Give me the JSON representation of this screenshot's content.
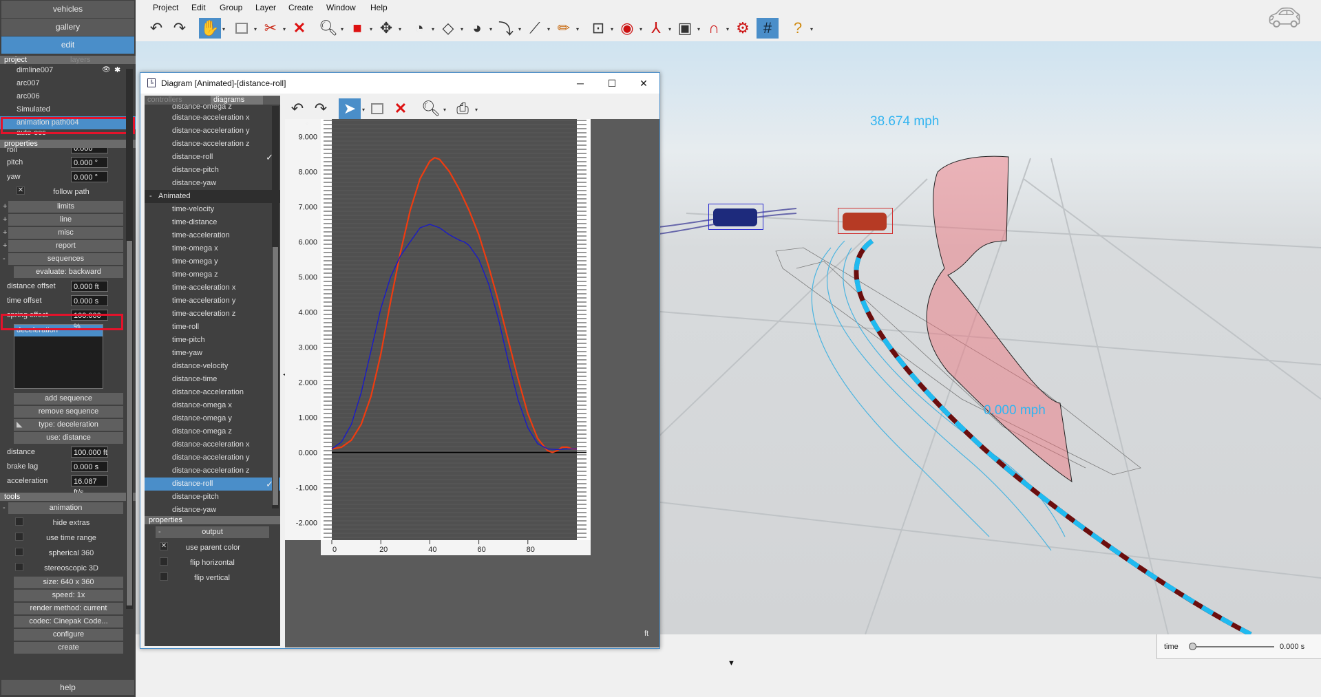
{
  "left_panel": {
    "top_buttons": [
      "vehicles",
      "gallery",
      "edit"
    ],
    "project_tab": "project",
    "layers_tab": "layers",
    "project_items": [
      "dimline007",
      "arc007",
      "arc006",
      "Simulated",
      "animation path004",
      "auto-ees"
    ],
    "properties_label": "properties",
    "props_top": [
      {
        "label": "roll",
        "value": "0.000"
      },
      {
        "label": "pitch",
        "value": "0.000 °"
      },
      {
        "label": "yaw",
        "value": "0.000 °"
      }
    ],
    "follow_path": "follow path",
    "groups": [
      "limits",
      "line",
      "misc",
      "report",
      "sequences"
    ],
    "evaluate": "evaluate: backward",
    "props_seq": [
      {
        "label": "distance offset",
        "value": "0.000 ft"
      },
      {
        "label": "time offset",
        "value": "0.000 s"
      },
      {
        "label": "spring effect",
        "value": "100.000 %"
      }
    ],
    "sequence_list": [
      "deceleration"
    ],
    "add_sequence": "add sequence",
    "remove_sequence": "remove sequence",
    "type": "type: deceleration",
    "use": "use: distance",
    "props_decel": [
      {
        "label": "distance",
        "value": "100.000 ft"
      },
      {
        "label": "brake lag",
        "value": "0.000 s"
      },
      {
        "label": "acceleration",
        "value": "16.087 ft/s"
      }
    ],
    "tools_label": "tools",
    "animation_label": "animation",
    "animation_checks": [
      "hide extras",
      "use time range",
      "spherical 360",
      "stereoscopic 3D"
    ],
    "animation_buttons": [
      "size: 640 x 360",
      "speed: 1x",
      "render method: current",
      "codec: Cinepak Code...",
      "configure",
      "create"
    ],
    "help": "help"
  },
  "menu": [
    "Project",
    "Edit",
    "Group",
    "Layer",
    "Create",
    "Window",
    "Help"
  ],
  "toolbar_icons": [
    "undo-icon",
    "redo-icon",
    "hand-icon",
    "select-rect-icon",
    "filter-delete-icon",
    "delete-icon",
    "zoom-icon",
    "cube-icon",
    "move-icon",
    "dial-icon",
    "plane-icon",
    "gauge-icon",
    "curve-icon",
    "measure-icon",
    "pencil-icon",
    "target-rect-icon",
    "record-icon",
    "axis-icon",
    "camera-icon",
    "magnet-icon",
    "gear-icon",
    "grid-icon",
    "help-icon"
  ],
  "viewport": {
    "speed_label_1": "38.674 mph",
    "speed_label_2": "0.000 mph",
    "time_label": "time",
    "time_value": "0.000 s"
  },
  "diagram_window": {
    "title": "Diagram [Animated]-[distance-roll]",
    "tabs": [
      "controllers",
      "diagrams"
    ],
    "items_top": [
      "distance-omega z",
      "distance-acceleration x",
      "distance-acceleration y",
      "distance-acceleration z",
      "distance-roll",
      "distance-pitch",
      "distance-yaw"
    ],
    "group_label": "Animated",
    "items_animated": [
      "time-velocity",
      "time-distance",
      "time-acceleration",
      "time-omega x",
      "time-omega y",
      "time-omega z",
      "time-acceleration x",
      "time-acceleration y",
      "time-acceleration z",
      "time-roll",
      "time-pitch",
      "time-yaw",
      "distance-velocity",
      "distance-time",
      "distance-acceleration",
      "distance-omega x",
      "distance-omega y",
      "distance-omega z",
      "distance-acceleration x",
      "distance-acceleration y",
      "distance-acceleration z",
      "distance-roll",
      "distance-pitch",
      "distance-yaw"
    ],
    "properties_label": "properties",
    "output_label": "output",
    "output_checks": [
      "use parent color",
      "flip horizontal",
      "flip vertical"
    ],
    "unit_x": "ft",
    "unit_y": "°"
  },
  "chart_data": {
    "type": "line",
    "xlim": [
      0,
      100
    ],
    "ylim": [
      -2.5,
      9.5
    ],
    "x_ticks": [
      0,
      20,
      40,
      60,
      80
    ],
    "y_ticks": [
      "9.000",
      "8.000",
      "7.000",
      "6.000",
      "5.000",
      "4.000",
      "3.000",
      "2.000",
      "1.000",
      "0.000",
      "-1.000",
      "-2.000"
    ],
    "series": [
      {
        "color": "#f03c10",
        "x": [
          0,
          4,
          8,
          12,
          16,
          20,
          24,
          28,
          32,
          36,
          40,
          42,
          44,
          48,
          52,
          56,
          60,
          64,
          68,
          72,
          76,
          80,
          84,
          88,
          90,
          92,
          94,
          96,
          98,
          100
        ],
        "y": [
          0.1,
          0.15,
          0.35,
          0.8,
          1.6,
          2.8,
          4.3,
          5.7,
          6.9,
          7.8,
          8.3,
          8.4,
          8.35,
          8.0,
          7.5,
          6.9,
          6.2,
          5.3,
          4.3,
          3.2,
          2.1,
          1.1,
          0.4,
          0.05,
          0.0,
          0.05,
          0.15,
          0.15,
          0.1,
          0.1
        ]
      },
      {
        "color": "#1a1ac8",
        "x": [
          0,
          4,
          8,
          12,
          16,
          20,
          24,
          28,
          32,
          36,
          40,
          44,
          48,
          52,
          54,
          56,
          60,
          64,
          68,
          72,
          76,
          80,
          84,
          88,
          92,
          96,
          100
        ],
        "y": [
          0.1,
          0.3,
          0.8,
          1.7,
          2.9,
          4.1,
          5.0,
          5.6,
          6.0,
          6.4,
          6.5,
          6.4,
          6.2,
          6.05,
          6.0,
          5.9,
          5.5,
          4.8,
          3.8,
          2.6,
          1.5,
          0.7,
          0.25,
          0.1,
          0.08,
          0.1,
          0.1
        ]
      }
    ]
  }
}
